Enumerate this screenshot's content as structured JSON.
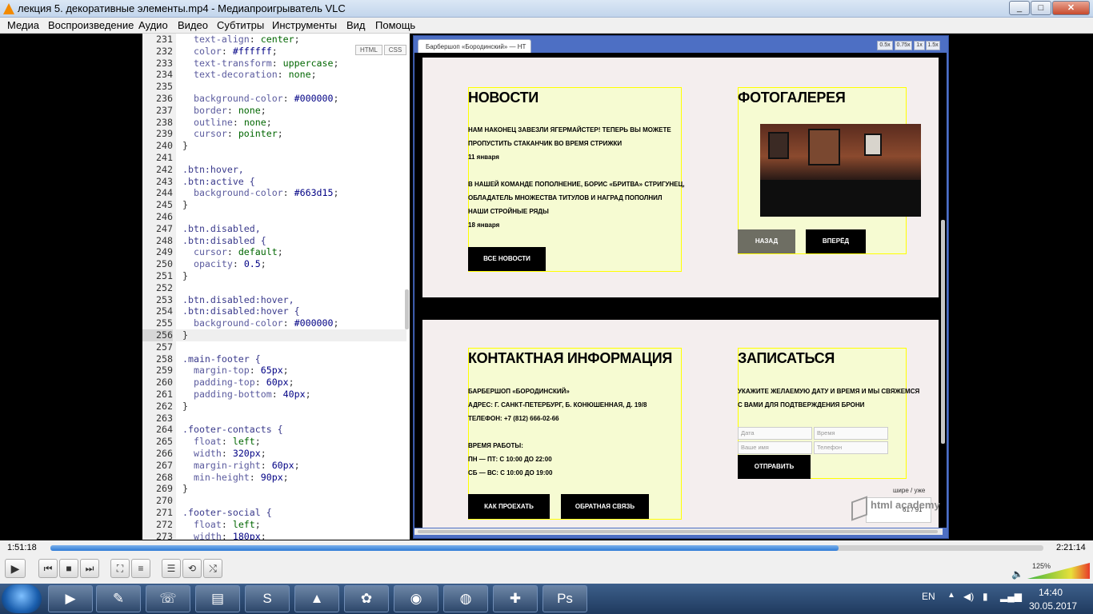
{
  "window": {
    "title": "лекция 5. декоративные элементы.mp4 - Медиапроигрыватель VLC",
    "minimize": "_",
    "maximize": "□",
    "close": "✕"
  },
  "menu": [
    "Медиа",
    "Воспроизведение",
    "Аудио",
    "Видео",
    "Субтитры",
    "Инструменты",
    "Вид",
    "Помощь"
  ],
  "editor": {
    "tabs": [
      "HTML",
      "CSS"
    ],
    "lines": [
      {
        "n": "231",
        "t": "  text-align: center;"
      },
      {
        "n": "232",
        "t": "  color: #ffffff;"
      },
      {
        "n": "233",
        "t": "  text-transform: uppercase;"
      },
      {
        "n": "234",
        "t": "  text-decoration: none;"
      },
      {
        "n": "235",
        "t": ""
      },
      {
        "n": "236",
        "t": "  background-color: #000000;"
      },
      {
        "n": "237",
        "t": "  border: none;"
      },
      {
        "n": "238",
        "t": "  outline: none;"
      },
      {
        "n": "239",
        "t": "  cursor: pointer;"
      },
      {
        "n": "240",
        "t": "}"
      },
      {
        "n": "241",
        "t": ""
      },
      {
        "n": "242",
        "t": ".btn:hover,"
      },
      {
        "n": "243",
        "t": ".btn:active {"
      },
      {
        "n": "244",
        "t": "  background-color: #663d15;"
      },
      {
        "n": "245",
        "t": "}"
      },
      {
        "n": "246",
        "t": ""
      },
      {
        "n": "247",
        "t": ".btn.disabled,"
      },
      {
        "n": "248",
        "t": ".btn:disabled {"
      },
      {
        "n": "249",
        "t": "  cursor: default;"
      },
      {
        "n": "250",
        "t": "  opacity: 0.5;"
      },
      {
        "n": "251",
        "t": "}"
      },
      {
        "n": "252",
        "t": ""
      },
      {
        "n": "253",
        "t": ".btn.disabled:hover,"
      },
      {
        "n": "254",
        "t": ".btn:disabled:hover {"
      },
      {
        "n": "255",
        "t": "  background-color: #000000;"
      },
      {
        "n": "256",
        "t": "}"
      },
      {
        "n": "257",
        "t": ""
      },
      {
        "n": "258",
        "t": ".main-footer {"
      },
      {
        "n": "259",
        "t": "  margin-top: 65px;"
      },
      {
        "n": "260",
        "t": "  padding-top: 60px;"
      },
      {
        "n": "261",
        "t": "  padding-bottom: 40px;"
      },
      {
        "n": "262",
        "t": "}"
      },
      {
        "n": "263",
        "t": ""
      },
      {
        "n": "264",
        "t": ".footer-contacts {"
      },
      {
        "n": "265",
        "t": "  float: left;"
      },
      {
        "n": "266",
        "t": "  width: 320px;"
      },
      {
        "n": "267",
        "t": "  margin-right: 60px;"
      },
      {
        "n": "268",
        "t": "  min-height: 90px;"
      },
      {
        "n": "269",
        "t": "}"
      },
      {
        "n": "270",
        "t": ""
      },
      {
        "n": "271",
        "t": ".footer-social {"
      },
      {
        "n": "272",
        "t": "  float: left;"
      },
      {
        "n": "273",
        "t": "  width: 180px;"
      }
    ],
    "current_line": "256"
  },
  "preview": {
    "tab_title": "Барбершоп «Бородинский» — НТ",
    "zoom": [
      "0.5x",
      "0.75x",
      "1x",
      "1.5x"
    ],
    "news": {
      "title": "НОВОСТИ",
      "item1_l1": "НАМ НАКОНЕЦ ЗАВЕЗЛИ ЯГЕРМАЙСТЕР! ТЕПЕРЬ ВЫ МОЖЕТЕ",
      "item1_l2": "ПРОПУСТИТЬ СТАКАНЧИК ВО ВРЕМЯ СТРИЖКИ",
      "item1_date": "11 января",
      "item2_l1": "В НАШЕЙ КОМАНДЕ ПОПОЛНЕНИЕ, БОРИС «БРИТВА» СТРИГУНЕЦ,",
      "item2_l2": "ОБЛАДАТЕЛЬ МНОЖЕСТВА ТИТУЛОВ И НАГРАД ПОПОЛНИЛ",
      "item2_l3": "НАШИ СТРОЙНЫЕ РЯДЫ",
      "item2_date": "18 января",
      "button": "ВСЕ НОВОСТИ"
    },
    "gallery": {
      "title": "ФОТОГАЛЕРЕЯ",
      "prev": "НАЗАД",
      "next": "ВПЕРЁД"
    },
    "contacts": {
      "title": "КОНТАКТНАЯ ИНФОРМАЦИЯ",
      "l1": "БАРБЕРШОП «БОРОДИНСКИЙ»",
      "l2": "АДРЕС: Г. САНКТ-ПЕТЕРБУРГ, Б. КОНЮШЕННАЯ, Д. 19/8",
      "l3": "ТЕЛЕФОН: +7 (812) 666-02-66",
      "l4": "ВРЕМЯ РАБОТЫ:",
      "l5": "ПН — ПТ: С 10:00 ДО 22:00",
      "l6": "СБ — ВС: С 10:00 ДО 19:00",
      "btn_route": "КАК ПРОЕХАТЬ",
      "btn_feedback": "ОБРАТНАЯ СВЯЗЬ"
    },
    "signup": {
      "title": "ЗАПИСАТЬСЯ",
      "l1": "УКАЖИТЕ ЖЕЛАЕМУЮ ДАТУ И ВРЕМЯ И МЫ СВЯЖЕМСЯ",
      "l2": "С ВАМИ ДЛЯ ПОДТВЕРЖДЕНИЯ БРОНИ",
      "date_ph": "Дата",
      "time_ph": "Время",
      "name_ph": "Ваше имя",
      "phone_ph": "Телефон",
      "submit": "ОТПРАВИТЬ"
    },
    "pager": {
      "label": "шире / уже",
      "count": "61 / 91",
      "watermark": "html academy"
    }
  },
  "player": {
    "elapsed": "1:51:18",
    "total": "2:21:14",
    "progress": 0.794,
    "volume": "125%"
  },
  "taskbar": {
    "lang": "EN",
    "time": "14:40",
    "date": "30.05.2017"
  }
}
